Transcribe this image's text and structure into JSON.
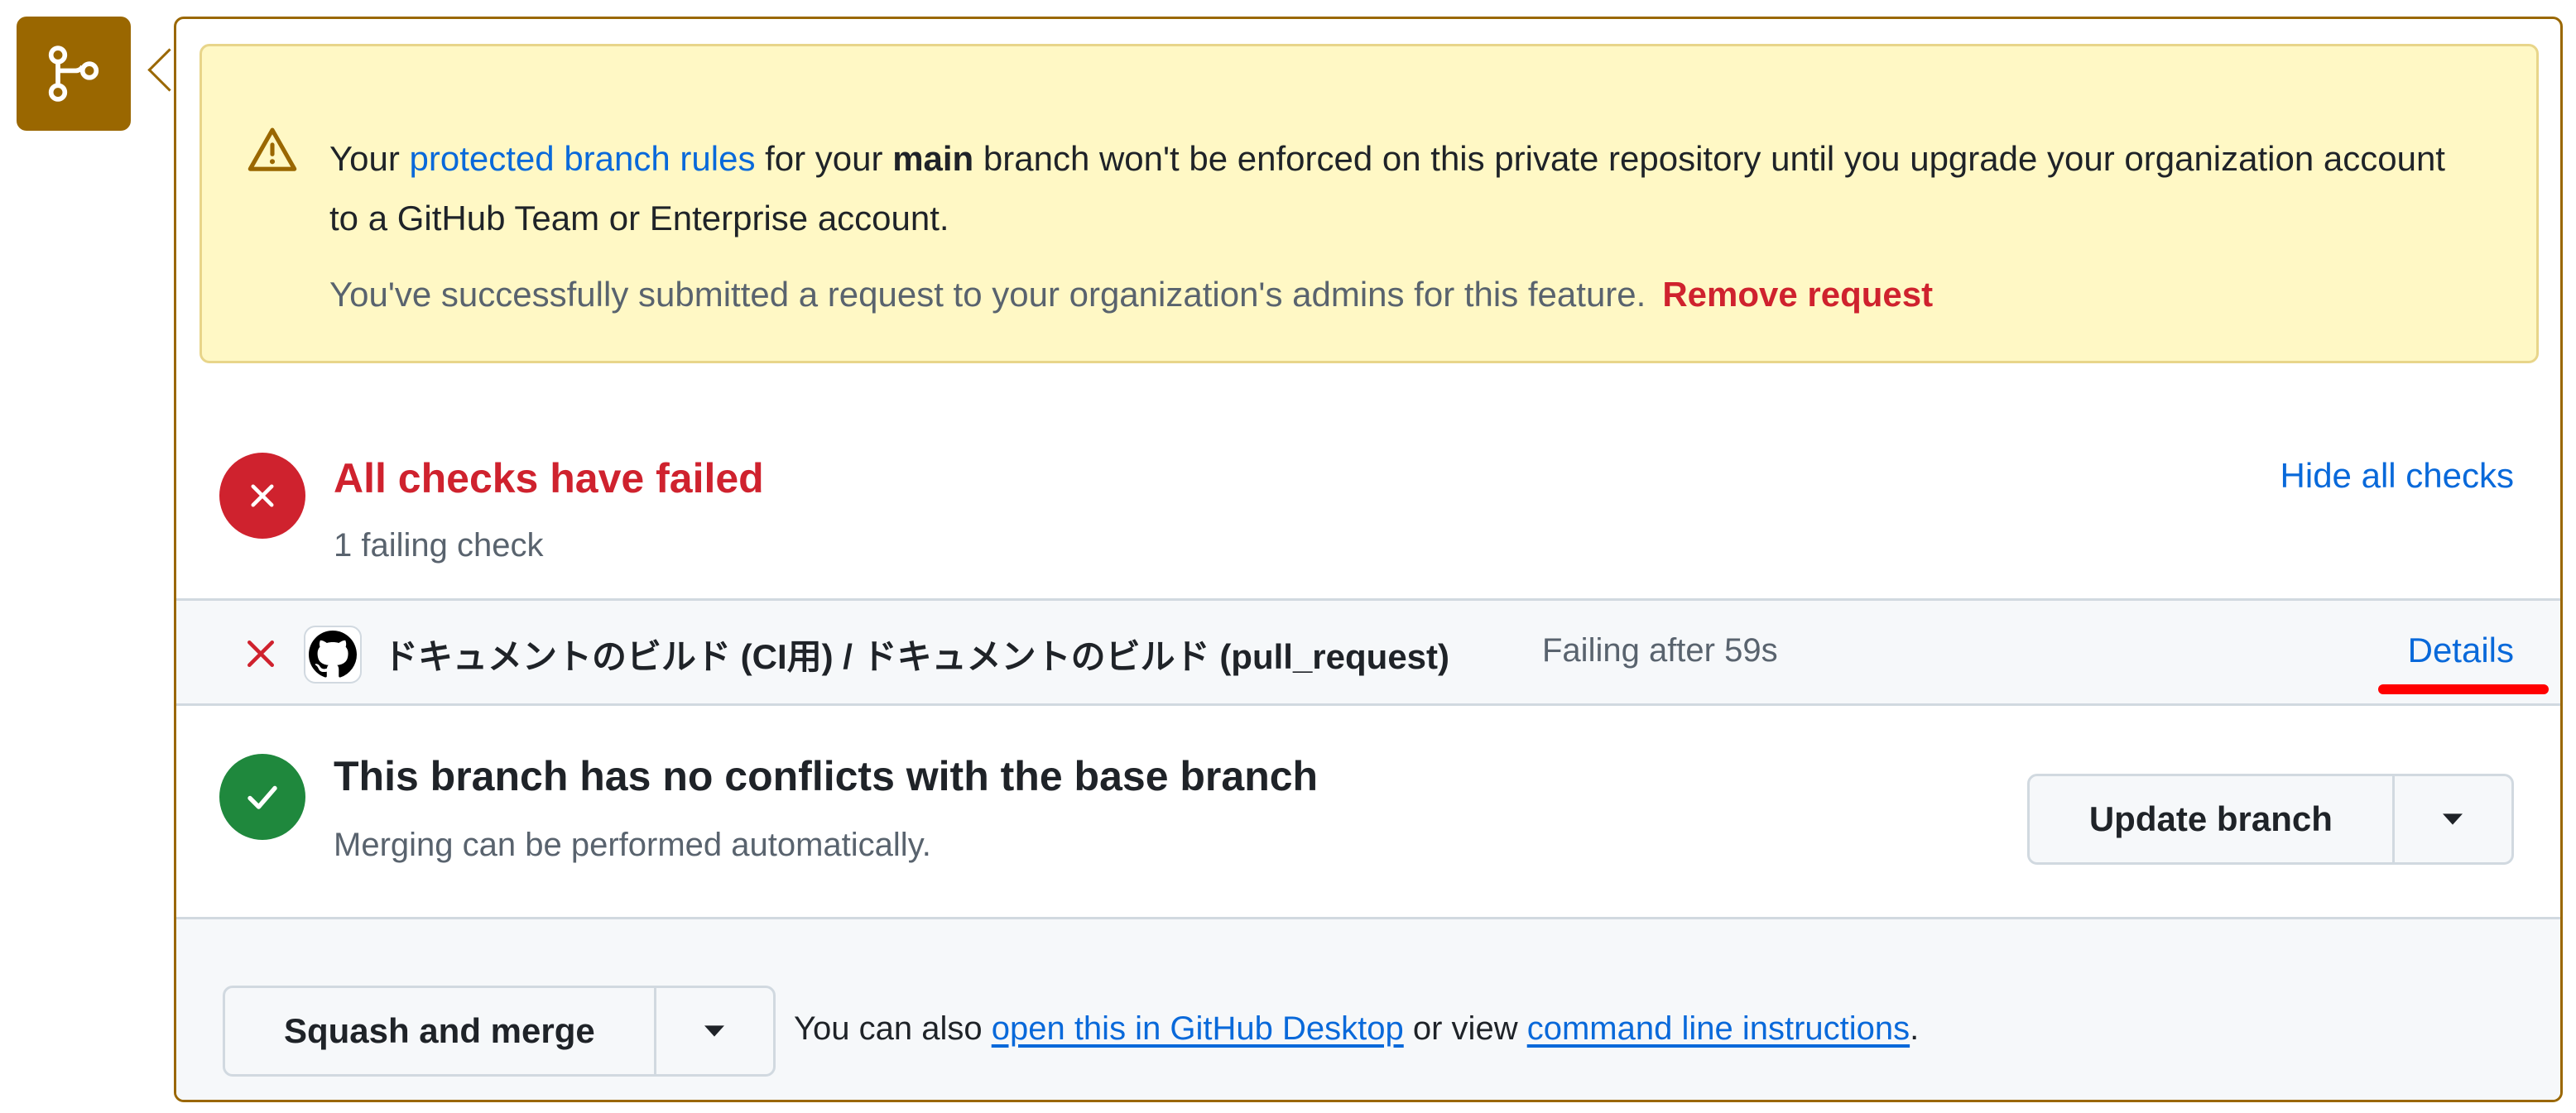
{
  "banner": {
    "text_your": "Your ",
    "link_protected": "protected branch rules",
    "text_for_your": " for your ",
    "branch_name": "main",
    "text_rest": " branch won't be enforced on this private repository until you upgrade your organization account to a GitHub Team or Enterprise account.",
    "request_text": "You've successfully submitted a request to your organization's admins for this feature.",
    "remove_request": "Remove request"
  },
  "checks": {
    "title": "All checks have failed",
    "subtitle": "1 failing check",
    "hide_all": "Hide all checks",
    "items": [
      {
        "name": "ドキュメントのビルド (CI用) / ドキュメントのビルド (pull_request)",
        "status": "Failing after 59s",
        "details": "Details"
      }
    ]
  },
  "conflicts": {
    "title": "This branch has no conflicts with the base branch",
    "subtitle": "Merging can be performed automatically.",
    "update_button": "Update branch"
  },
  "merge": {
    "button": "Squash and merge",
    "text_prefix": "You can also ",
    "desktop_link": "open this in GitHub Desktop",
    "text_middle": " or view ",
    "cli_link": "command line instructions",
    "text_suffix": "."
  },
  "colors": {
    "merge_icon_bg": "#9a6700",
    "banner_bg": "#fff8c5",
    "fail": "#cf222e",
    "success": "#1f883d",
    "link": "#0969da",
    "annotation": "#ff0000"
  },
  "icons": {
    "merge_state": "git-branch-icon",
    "banner": "alert-triangle-icon",
    "fail": "x-circle-icon",
    "check_provider": "github-logo-icon",
    "success": "check-circle-icon",
    "dropdown": "triangle-down-icon"
  }
}
